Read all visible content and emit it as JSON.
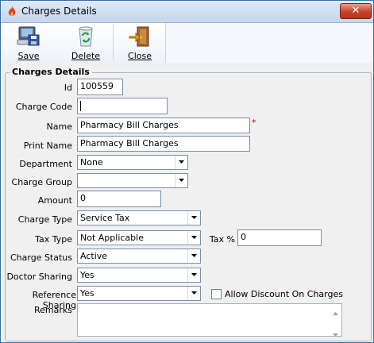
{
  "window": {
    "title": "Charges  Details",
    "close_glyph": "✕",
    "app_icon": "flame-app-icon"
  },
  "toolbar": {
    "save_label": "Save",
    "delete_label": "Delete",
    "close_label": "Close",
    "save_icon": "floppy-computer-icon",
    "delete_icon": "recycle-bin-icon",
    "close_icon": "exit-door-icon"
  },
  "form": {
    "section_title": "Charges Details",
    "fields": {
      "id": {
        "label": "Id",
        "value": "100559"
      },
      "charge_code": {
        "label": "Charge Code",
        "value": ""
      },
      "name": {
        "label": "Name",
        "value": "Pharmacy Bill Charges",
        "required_mark": "*"
      },
      "print_name": {
        "label": "Print Name",
        "value": "Pharmacy Bill Charges"
      },
      "department": {
        "label": "Department",
        "value": "None"
      },
      "charge_group": {
        "label": "Charge Group",
        "value": ""
      },
      "amount": {
        "label": "Amount",
        "value": "0"
      },
      "charge_type": {
        "label": "Charge Type",
        "value": "Service Tax"
      },
      "tax_type": {
        "label": "Tax Type",
        "value": "Not Applicable"
      },
      "tax_percent": {
        "label": "Tax %",
        "value": "0"
      },
      "charge_status": {
        "label": "Charge Status",
        "value": "Active"
      },
      "doctor_sharing": {
        "label": "Doctor Sharing",
        "value": "Yes"
      },
      "reference_sharing": {
        "label": "Reference Sharing",
        "value": "Yes"
      },
      "allow_discount": {
        "label": "Allow Discount On Charges",
        "checked": false
      },
      "remarks": {
        "label": "Remarks",
        "value": ""
      }
    }
  },
  "colors": {
    "title_gradient_top": "#dfe9f5",
    "close_button": "#c7412b",
    "required_mark": "#c00000",
    "field_border": "#7a8ea8"
  }
}
